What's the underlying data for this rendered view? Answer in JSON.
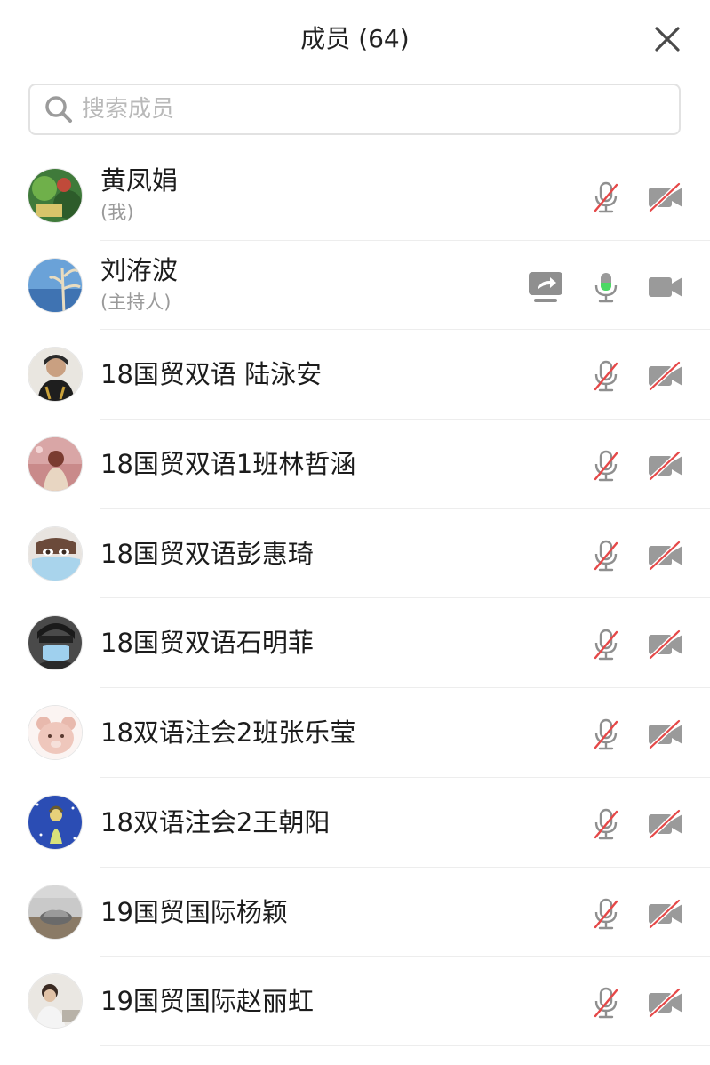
{
  "header": {
    "title": "成员 (64)",
    "close_icon": "close-icon"
  },
  "search": {
    "placeholder": "搜索成员",
    "value": "",
    "icon": "search-icon"
  },
  "colors": {
    "muted_red": "#e54848",
    "icon_gray": "#8f8f8f",
    "speaking_green": "#4cd964"
  },
  "members": [
    {
      "name": "黄凤娟",
      "role": "(我)",
      "mic": "muted",
      "camera": "off",
      "sharing": false
    },
    {
      "name": "刘洊波",
      "role": "(主持人)",
      "mic": "on",
      "camera": "on",
      "sharing": true
    },
    {
      "name": "18国贸双语 陆泳安",
      "role": "",
      "mic": "muted",
      "camera": "off",
      "sharing": false
    },
    {
      "name": "18国贸双语1班林哲涵",
      "role": "",
      "mic": "muted",
      "camera": "off",
      "sharing": false
    },
    {
      "name": "18国贸双语彭惠琦",
      "role": "",
      "mic": "muted",
      "camera": "off",
      "sharing": false
    },
    {
      "name": "18国贸双语石明菲",
      "role": "",
      "mic": "muted",
      "camera": "off",
      "sharing": false
    },
    {
      "name": "18双语注会2班张乐莹",
      "role": "",
      "mic": "muted",
      "camera": "off",
      "sharing": false
    },
    {
      "name": "18双语注会2王朝阳",
      "role": "",
      "mic": "muted",
      "camera": "off",
      "sharing": false
    },
    {
      "name": "19国贸国际杨颖",
      "role": "",
      "mic": "muted",
      "camera": "off",
      "sharing": false
    },
    {
      "name": "19国贸国际赵丽虹",
      "role": "",
      "mic": "muted",
      "camera": "off",
      "sharing": false
    }
  ]
}
